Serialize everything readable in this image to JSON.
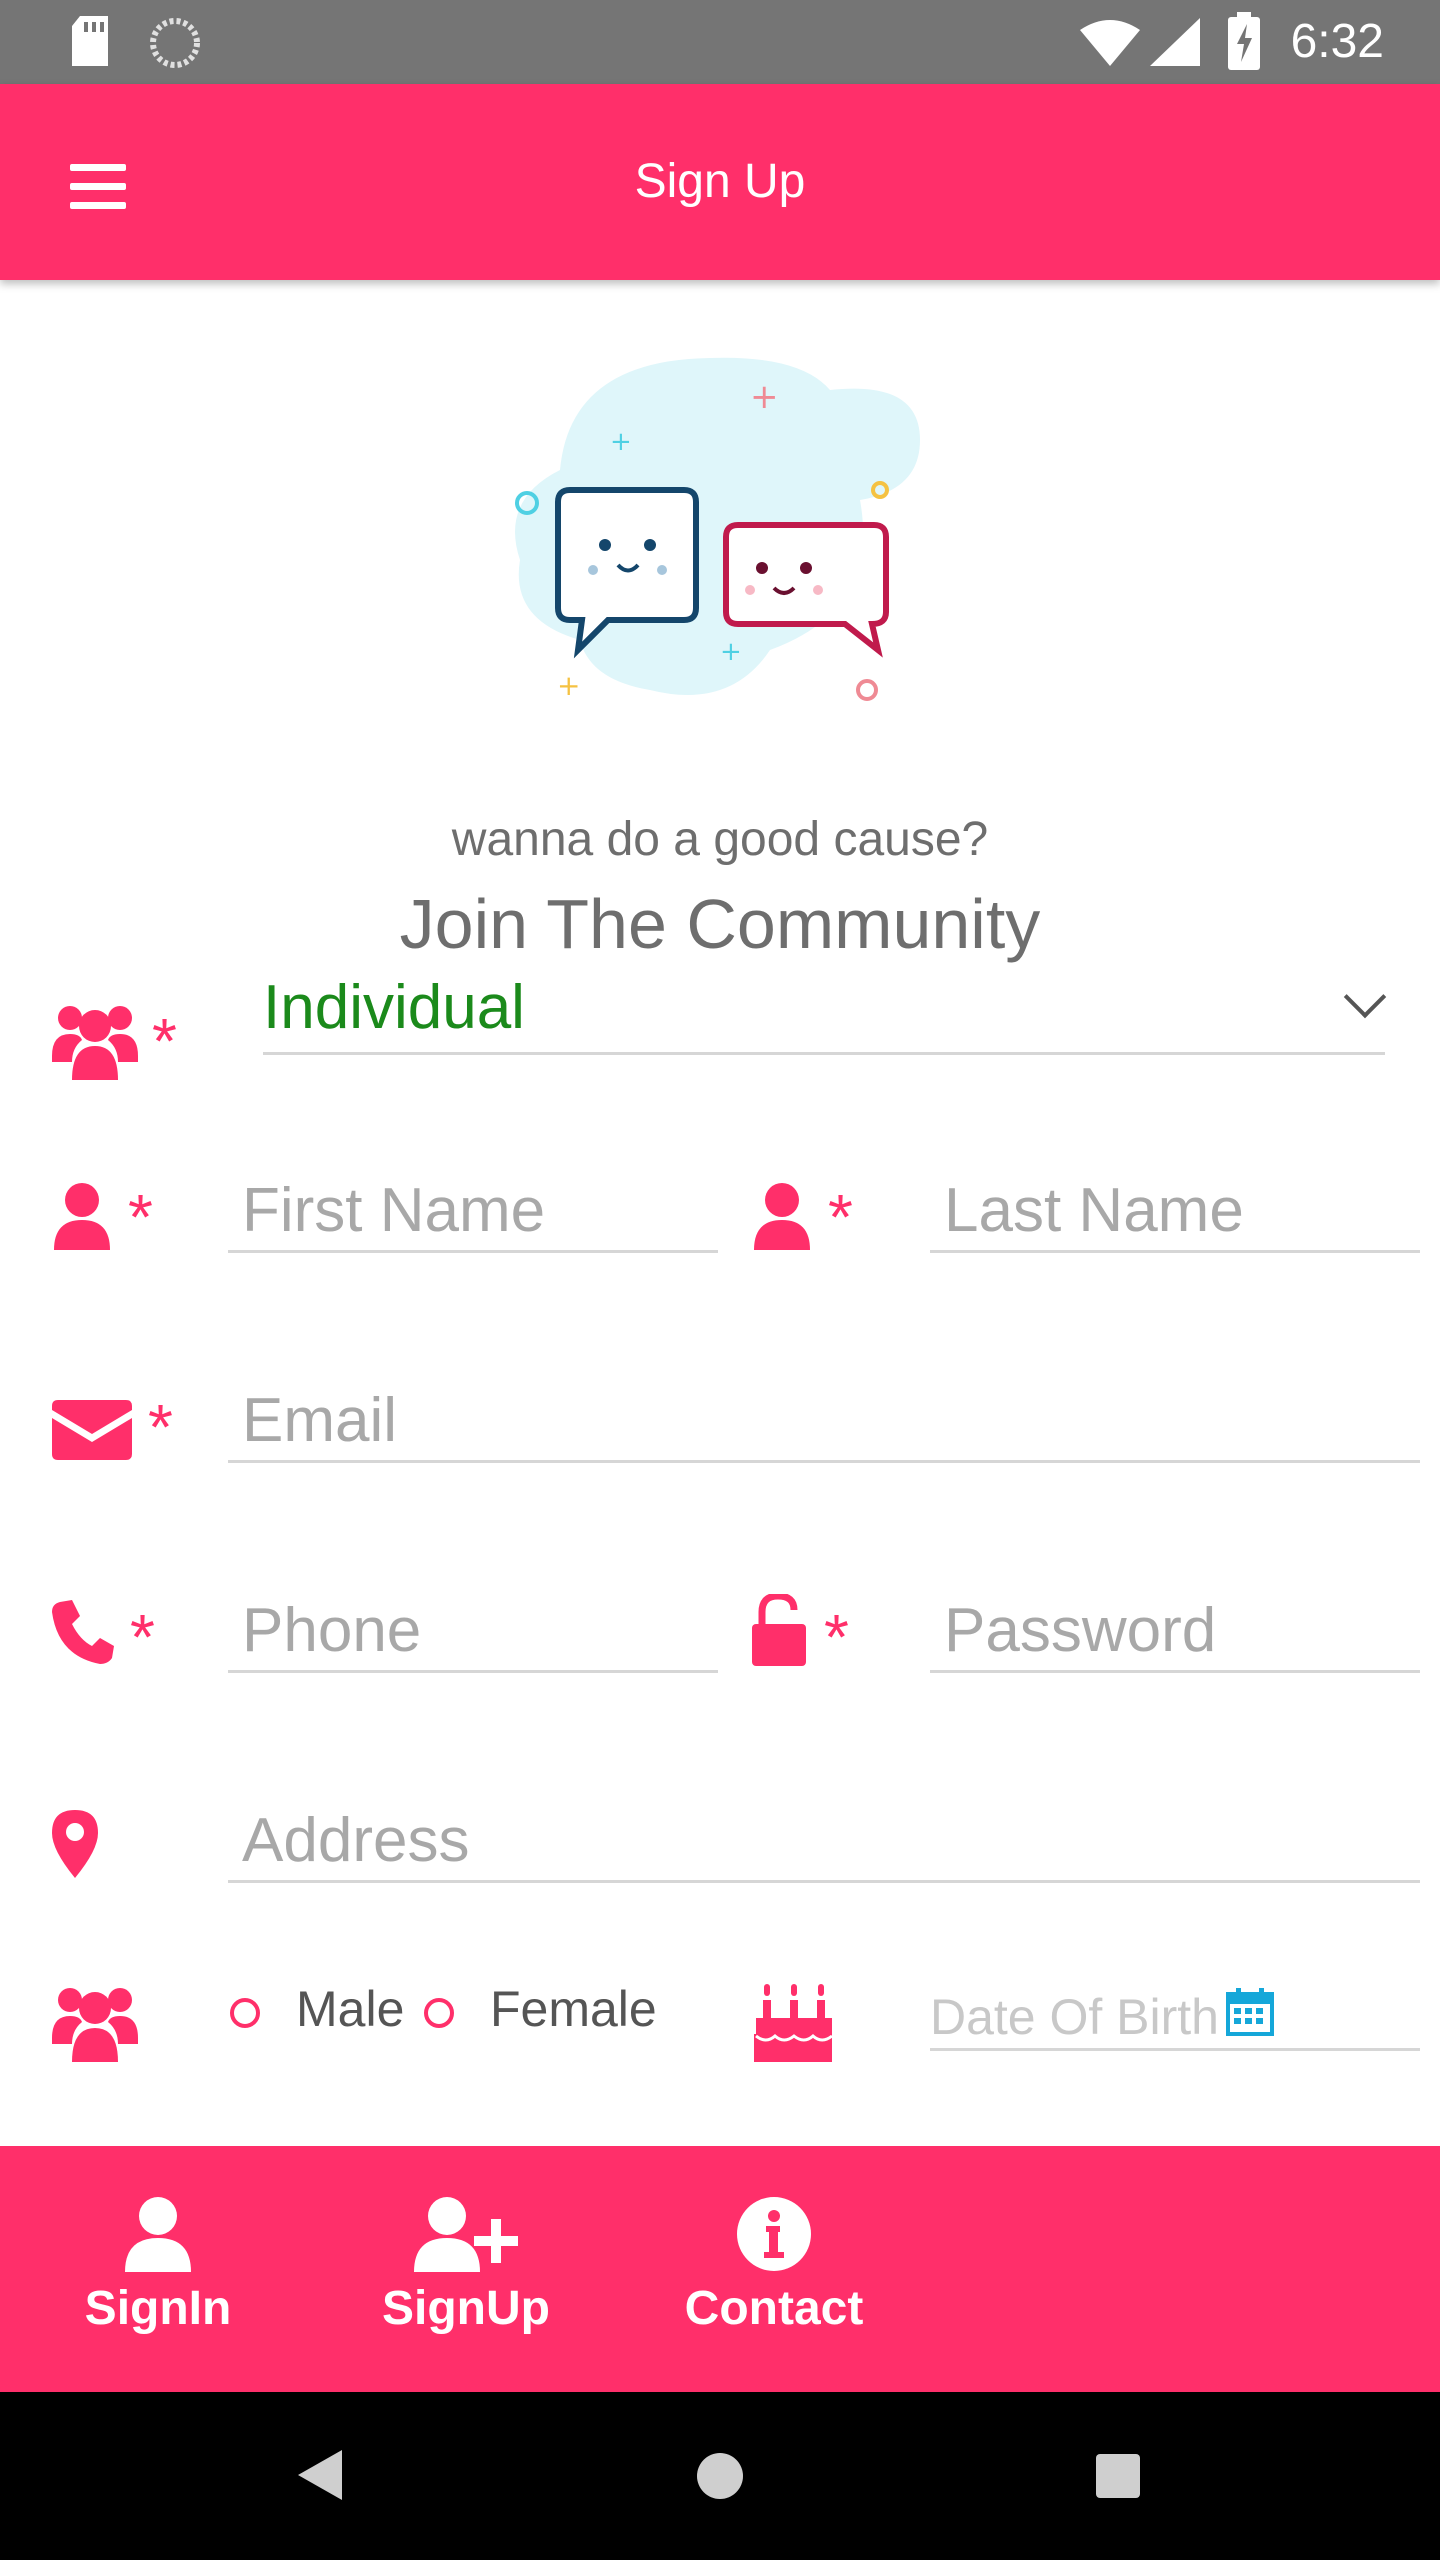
{
  "status_bar": {
    "time": "6:32"
  },
  "app_bar": {
    "title": "Sign Up"
  },
  "intro": {
    "tagline": "wanna do a good cause?",
    "heading": "Join The Community"
  },
  "form": {
    "type_select": {
      "value": "Individual"
    },
    "first_name": {
      "placeholder": "First Name"
    },
    "last_name": {
      "placeholder": "Last Name"
    },
    "email": {
      "placeholder": "Email"
    },
    "phone": {
      "placeholder": "Phone"
    },
    "password": {
      "placeholder": "Password"
    },
    "address": {
      "placeholder": "Address"
    },
    "gender": {
      "male_label": "Male",
      "female_label": "Female"
    },
    "dob": {
      "placeholder": "Date Of Birth"
    },
    "required_marker": "*"
  },
  "bottom_nav": {
    "items": [
      {
        "label": "SignIn",
        "icon": "user-icon"
      },
      {
        "label": "SignUp",
        "icon": "user-plus-icon"
      },
      {
        "label": "Contact",
        "icon": "info-circle-icon"
      }
    ]
  },
  "colors": {
    "primary": "#ff2f6a",
    "select_value": "#1b8a1b",
    "status_bar": "#757575"
  }
}
